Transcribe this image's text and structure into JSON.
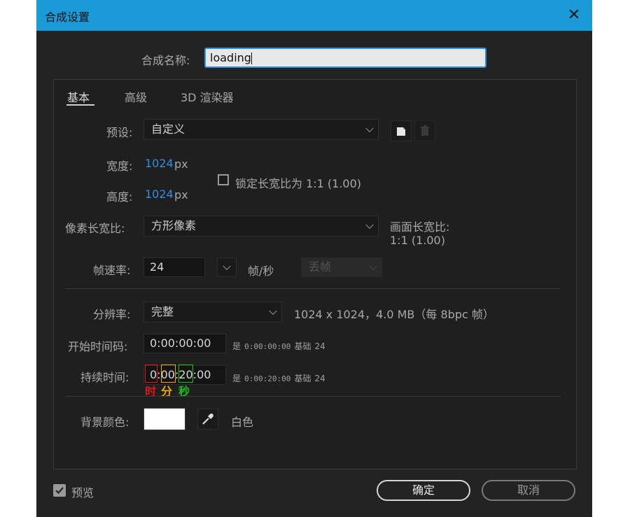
{
  "window": {
    "title": "合成设置"
  },
  "comp_name": {
    "label": "合成名称:",
    "value": "loading"
  },
  "tabs": [
    {
      "label": "基本"
    },
    {
      "label": "高级"
    },
    {
      "label": "3D 渲染器"
    }
  ],
  "preset": {
    "label": "预设:",
    "value": "自定义"
  },
  "width": {
    "label": "宽度:",
    "value": "1024",
    "unit": "px"
  },
  "height": {
    "label": "高度:",
    "value": "1024",
    "unit": "px"
  },
  "lock_ratio": {
    "label": "锁定长宽比为 1:1 (1.00)",
    "checked": false
  },
  "pixel_aspect": {
    "label": "像素长宽比:",
    "value": "方形像素"
  },
  "frame_aspect": {
    "label": "画面长宽比:",
    "value": "1:1 (1.00)"
  },
  "frame_rate": {
    "label": "帧速率:",
    "value": "24",
    "unit": "帧/秒",
    "drop_frame": "丢帧"
  },
  "resolution": {
    "label": "分辨率:",
    "value": "完整",
    "info": "1024 x 1024，4.0 MB（每 8bpc 帧）"
  },
  "start_timecode": {
    "label": "开始时间码:",
    "value": "0:00:00:00",
    "is": "是",
    "tc": "0:00:00:00",
    "base": "基础",
    "base_value": "24"
  },
  "duration": {
    "label": "持续时间:",
    "value": "0:00:20:00",
    "is": "是",
    "tc": "0:00:20:00",
    "base": "基础",
    "base_value": "24",
    "annotations": {
      "hour": "时",
      "minute": "分",
      "second": "秒"
    }
  },
  "background": {
    "label": "背景颜色:",
    "color_name": "白色",
    "swatch": "#ffffff"
  },
  "preview": {
    "label": "预览",
    "checked": true
  },
  "buttons": {
    "ok": "确定",
    "cancel": "取消"
  },
  "colors": {
    "title_bar": "#1a9ad6",
    "value_blue": "#2f8fe0",
    "hour_mark": "#e01818",
    "minute_mark": "#f0a800",
    "second_mark": "#18c018"
  }
}
